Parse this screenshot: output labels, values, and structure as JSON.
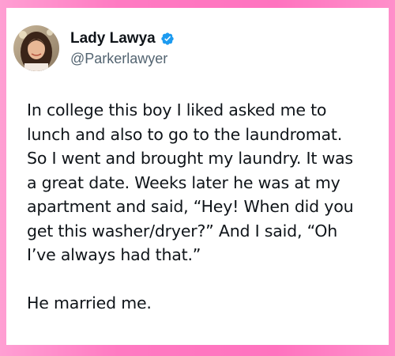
{
  "author": {
    "display_name": "Lady Lawya",
    "handle": "@Parkerlawyer",
    "verified_icon": "verified-badge-icon",
    "verified_color": "#1d9bf0"
  },
  "tweet": {
    "lines": [
      "In college this boy I liked asked me to",
      "lunch and also to go to the laundromat.",
      "So I went and brought my laundry. It was",
      "a great date. Weeks later he was at my",
      "apartment and said, “Hey! When did you",
      "get this washer/dryer?” And I said, “Oh",
      "I’ve always had that.”"
    ],
    "closing_line": "He married me."
  },
  "colors": {
    "background_pink": "#ff7ac2",
    "text": "#0f1419",
    "handle_gray": "#536471"
  }
}
